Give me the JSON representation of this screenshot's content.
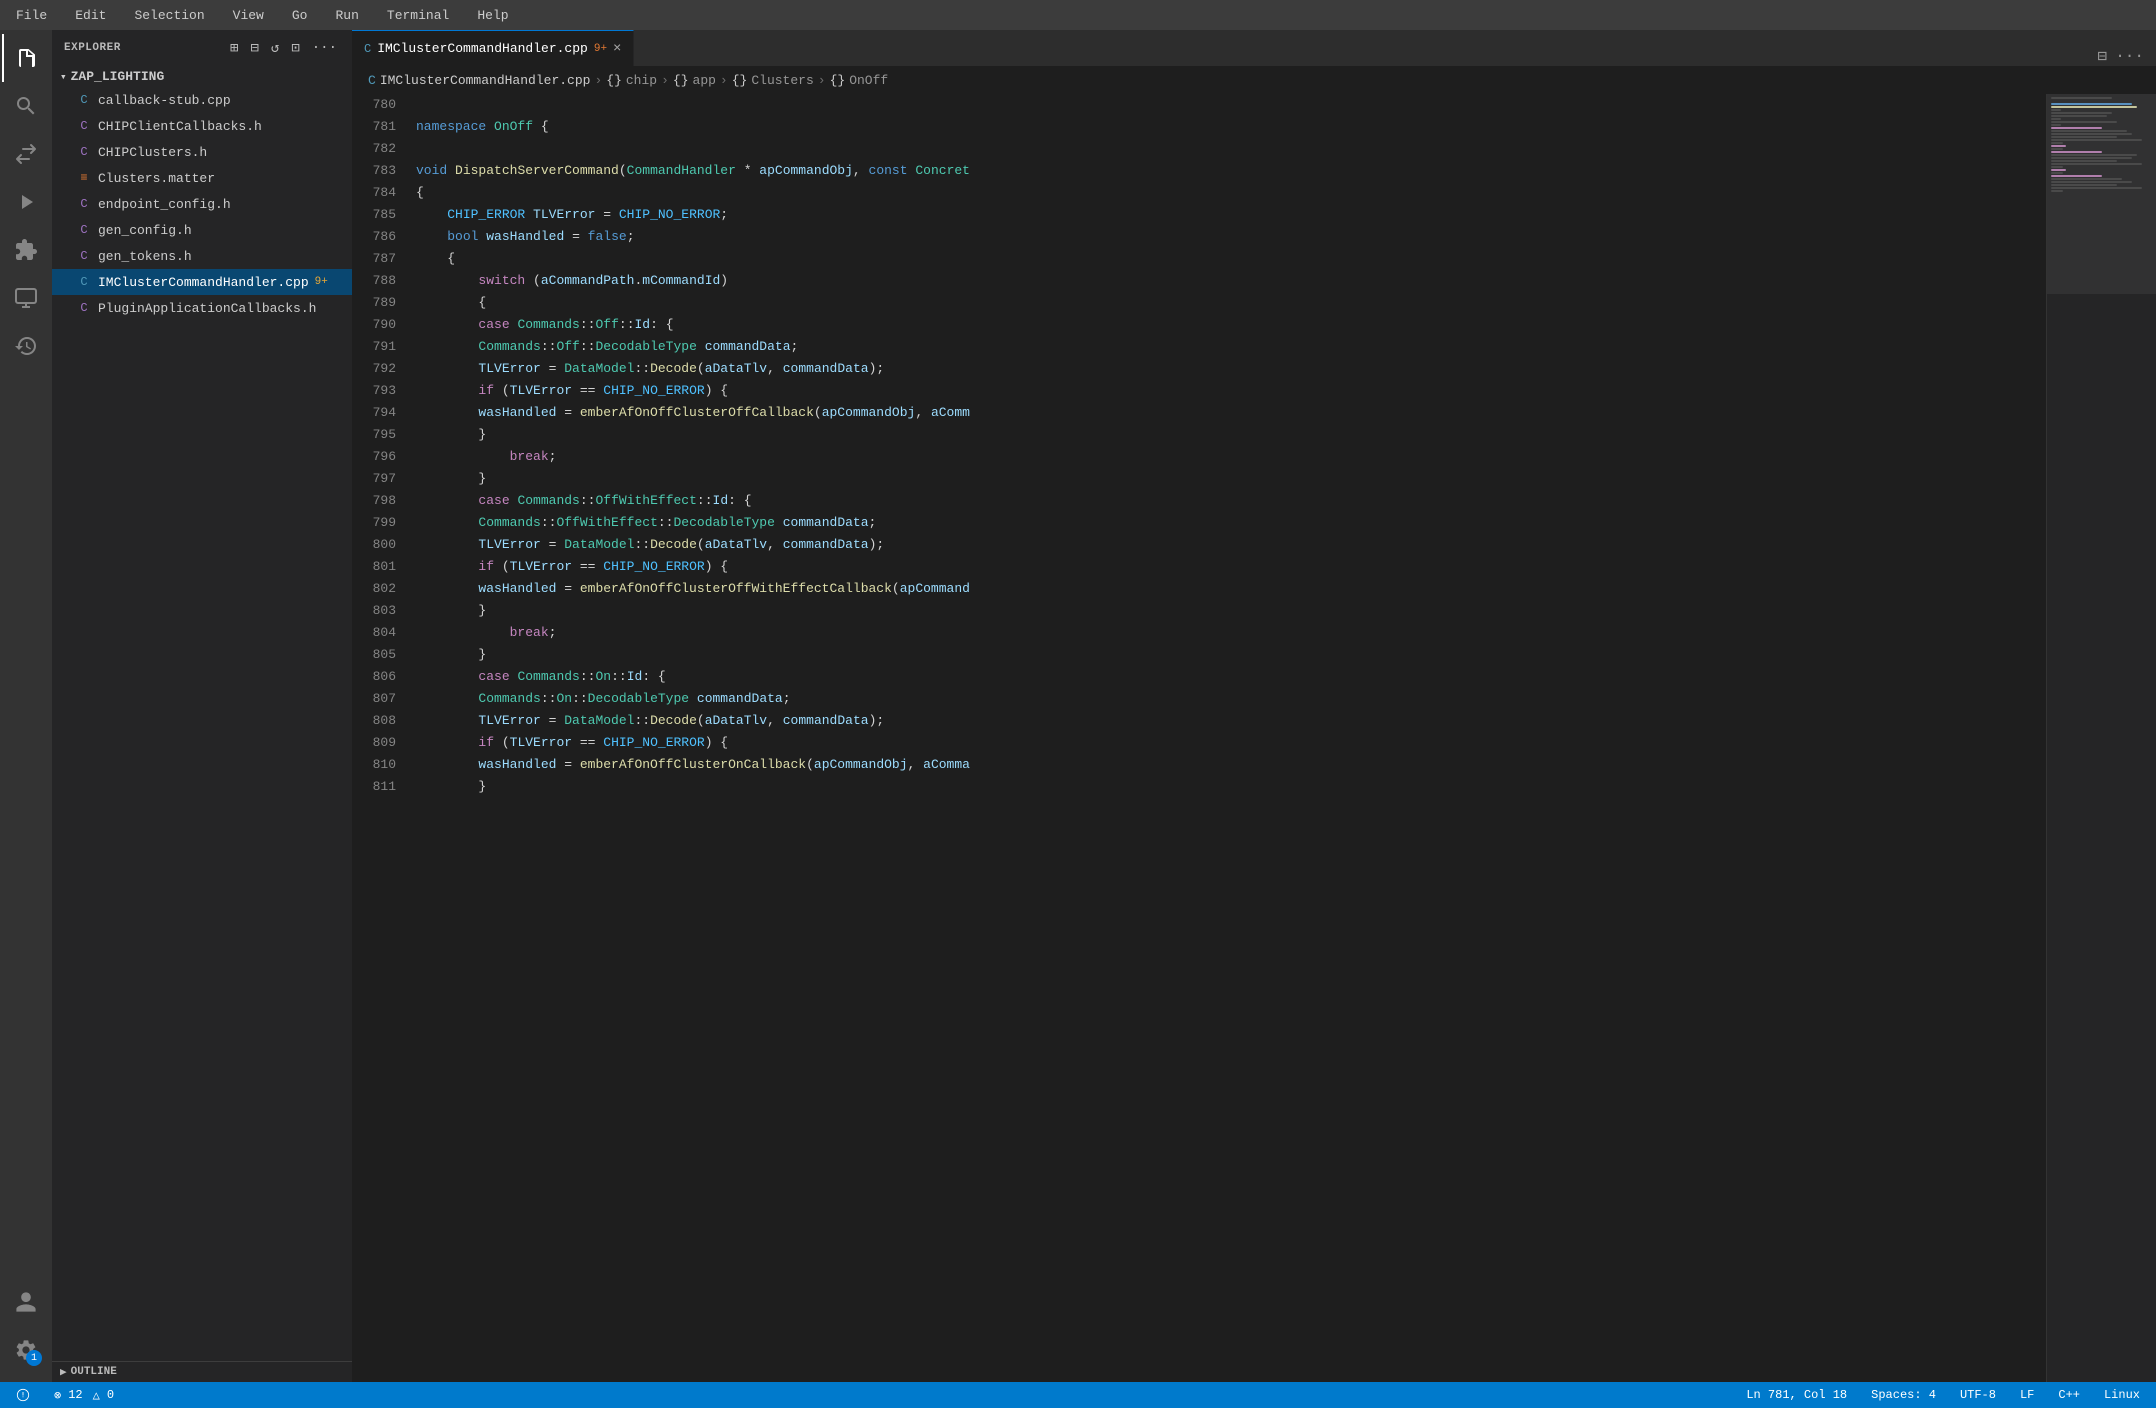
{
  "menu": {
    "items": [
      "File",
      "Edit",
      "Selection",
      "View",
      "Go",
      "Run",
      "Terminal",
      "Help"
    ]
  },
  "activity_bar": {
    "icons": [
      {
        "name": "files-icon",
        "symbol": "⎘",
        "active": true
      },
      {
        "name": "search-icon",
        "symbol": "🔍",
        "active": false
      },
      {
        "name": "source-control-icon",
        "symbol": "⎇",
        "active": false
      },
      {
        "name": "run-debug-icon",
        "symbol": "▷",
        "active": false
      },
      {
        "name": "extensions-icon",
        "symbol": "⧉",
        "active": false
      },
      {
        "name": "remote-explorer-icon",
        "symbol": "🖥",
        "active": false
      },
      {
        "name": "timeline-icon",
        "symbol": "⏱",
        "active": false
      }
    ],
    "bottom_icons": [
      {
        "name": "account-icon",
        "symbol": "👤"
      },
      {
        "name": "settings-icon",
        "symbol": "⚙",
        "badge": "1"
      }
    ]
  },
  "sidebar": {
    "title": "EXPLORER",
    "more_label": "···",
    "root": {
      "name": "ZAP_LIGHTING",
      "expanded": true
    },
    "files": [
      {
        "name": "callback-stub.cpp",
        "type": "cpp"
      },
      {
        "name": "CHIPClientCallbacks.h",
        "type": "h"
      },
      {
        "name": "CHIPClusters.h",
        "type": "h"
      },
      {
        "name": "Clusters.matter",
        "type": "matter"
      },
      {
        "name": "endpoint_config.h",
        "type": "h"
      },
      {
        "name": "gen_config.h",
        "type": "h"
      },
      {
        "name": "gen_tokens.h",
        "type": "h"
      },
      {
        "name": "IMClusterCommandHandler.cpp",
        "type": "cpp",
        "active": true,
        "modified": "9+"
      },
      {
        "name": "PluginApplicationCallbacks.h",
        "type": "h"
      }
    ],
    "outline": {
      "label": "OUTLINE"
    }
  },
  "editor": {
    "tab": {
      "icon": "G",
      "filename": "IMClusterCommandHandler.cpp",
      "modified": "9+",
      "close": "×"
    },
    "breadcrumb": [
      "IMClusterCommandHandler.cpp",
      "chip",
      "app",
      "Clusters",
      "OnOff"
    ],
    "lines": [
      {
        "num": 780,
        "content": ""
      },
      {
        "num": 781,
        "content": "namespace OnOff {"
      },
      {
        "num": 782,
        "content": ""
      },
      {
        "num": 783,
        "content": "void DispatchServerCommand(CommandHandler * apCommandObj, const Concret"
      },
      {
        "num": 784,
        "content": "{"
      },
      {
        "num": 785,
        "content": "    CHIP_ERROR TLVError = CHIP_NO_ERROR;"
      },
      {
        "num": 786,
        "content": "    bool wasHandled = false;"
      },
      {
        "num": 787,
        "content": "{"
      },
      {
        "num": 788,
        "content": "        switch (aCommandPath.mCommandId)"
      },
      {
        "num": 789,
        "content": "        {"
      },
      {
        "num": 790,
        "content": "        case Commands::Off::Id: {"
      },
      {
        "num": 791,
        "content": "        Commands::Off::DecodableType commandData;"
      },
      {
        "num": 792,
        "content": "        TLVError = DataModel::Decode(aDataTlv, commandData);"
      },
      {
        "num": 793,
        "content": "        if (TLVError == CHIP_NO_ERROR) {"
      },
      {
        "num": 794,
        "content": "        wasHandled = emberAfOnOffClusterOffCallback(apCommandObj, aComm"
      },
      {
        "num": 795,
        "content": "        }"
      },
      {
        "num": 796,
        "content": "            break;"
      },
      {
        "num": 797,
        "content": "        }"
      },
      {
        "num": 798,
        "content": "        case Commands::OffWithEffect::Id: {"
      },
      {
        "num": 799,
        "content": "        Commands::OffWithEffect::DecodableType commandData;"
      },
      {
        "num": 800,
        "content": "        TLVError = DataModel::Decode(aDataTlv, commandData);"
      },
      {
        "num": 801,
        "content": "        if (TLVError == CHIP_NO_ERROR) {"
      },
      {
        "num": 802,
        "content": "        wasHandled = emberAfOnOffClusterOffWithEffectCallback(apCommand"
      },
      {
        "num": 803,
        "content": "        }"
      },
      {
        "num": 804,
        "content": "            break;"
      },
      {
        "num": 805,
        "content": "        }"
      },
      {
        "num": 806,
        "content": "        case Commands::On::Id: {"
      },
      {
        "num": 807,
        "content": "        Commands::On::DecodableType commandData;"
      },
      {
        "num": 808,
        "content": "        TLVError = DataModel::Decode(aDataTlv, commandData);"
      },
      {
        "num": 809,
        "content": "        if (TLVError == CHIP_NO_ERROR) {"
      },
      {
        "num": 810,
        "content": "        wasHandled = emberAfOnOffClusterOnCallback(apCommandObj, aComma"
      },
      {
        "num": 811,
        "content": "        }"
      }
    ]
  },
  "status_bar": {
    "errors": "⊗ 12",
    "warnings": "△ 0",
    "position": "Ln 781, Col 18",
    "spaces": "Spaces: 4",
    "encoding": "UTF-8",
    "line_ending": "LF",
    "language": "C++",
    "os": "Linux"
  }
}
